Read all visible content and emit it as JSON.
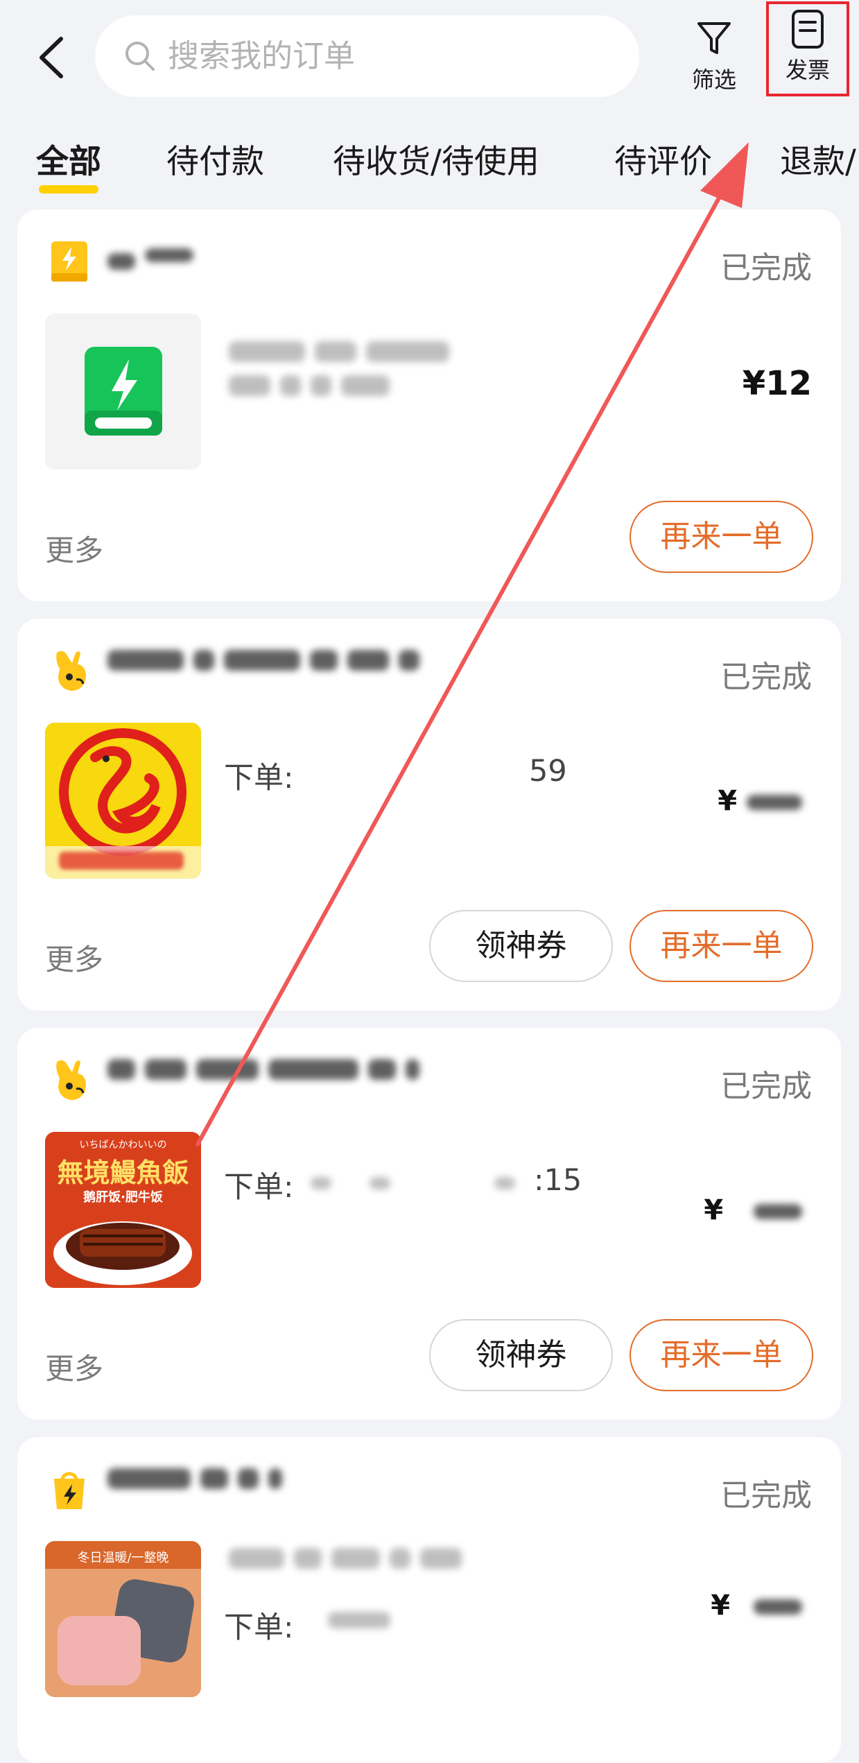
{
  "header": {
    "search_placeholder": "搜索我的订单",
    "filter_label": "筛选",
    "invoice_label": "发票"
  },
  "tabs": [
    {
      "label": "全部",
      "active": true
    },
    {
      "label": "待付款"
    },
    {
      "label": "待收货/待使用"
    },
    {
      "label": "待评价"
    },
    {
      "label": "退款/"
    }
  ],
  "orders": [
    {
      "status": "已完成",
      "price": "¥12",
      "more": "更多",
      "again_label": "再来一单",
      "icon": "power-bank-store-icon"
    },
    {
      "status": "已完成",
      "order_prefix": "下单:",
      "time_fragment": "59",
      "price_symbol": "¥",
      "more": "更多",
      "coupon_label": "领神券",
      "again_label": "再来一单",
      "icon": "meituan-kangaroo-icon"
    },
    {
      "status": "已完成",
      "order_prefix": "下单:",
      "time_fragment": ":15",
      "price_symbol": "¥",
      "more": "更多",
      "coupon_label": "领神券",
      "again_label": "再来一单",
      "icon": "meituan-kangaroo-icon",
      "thumb_title": "無境鰻魚飯",
      "thumb_sub": "鹅肝饭·肥牛饭",
      "thumb_top": "いちばんかわいいの"
    },
    {
      "status": "已完成",
      "order_prefix": "下单:",
      "price_symbol": "¥",
      "icon": "flash-shopping-bag-icon",
      "thumb_top": "冬日温暖/一整晚"
    }
  ],
  "colors": {
    "accent_yellow": "#ffd100",
    "accent_orange": "#e36d2a",
    "highlight_red": "#e8262f"
  }
}
